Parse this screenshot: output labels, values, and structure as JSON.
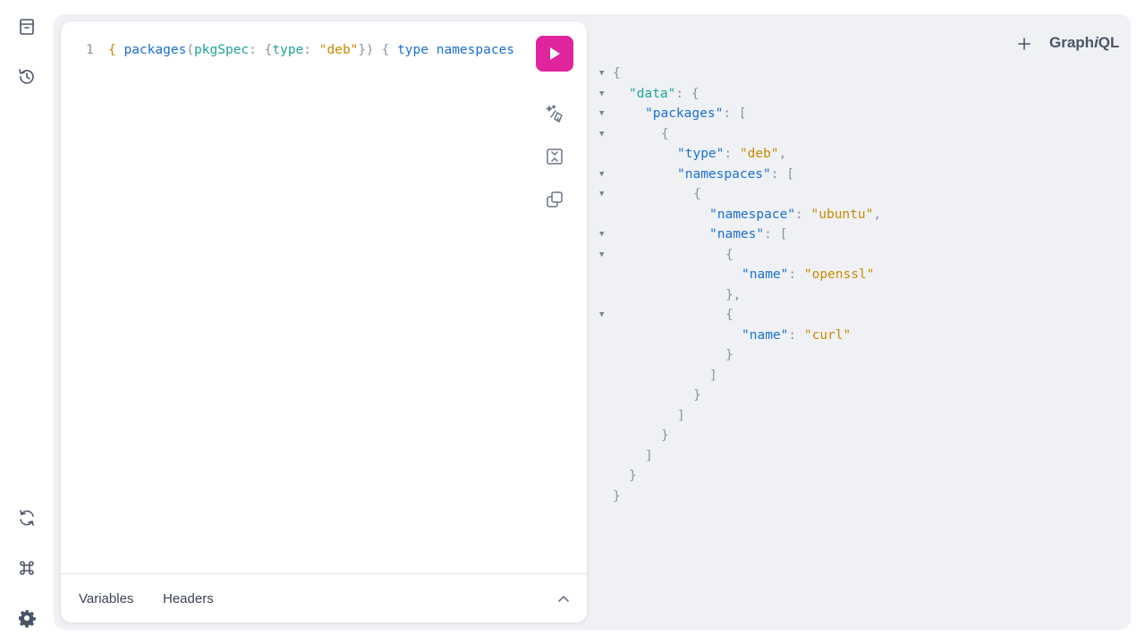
{
  "sidebar": {
    "top_icons": [
      "docs-icon",
      "history-icon"
    ],
    "bottom_icons": [
      "refetch-schema-icon",
      "keyboard-shortcuts-icon",
      "settings-icon"
    ]
  },
  "editor": {
    "line_number": "1",
    "query_tokens": {
      "open_brace": "{",
      "packages": "packages",
      "open_paren": "(",
      "pkgSpec": "pkgSpec",
      "colon1": ":",
      "open_obj": "{",
      "type_arg": "type",
      "colon2": ":",
      "deb_value": "\"deb\"",
      "close_obj_paren": "})",
      "open_brace2": "{",
      "type_field": "type",
      "namespaces_field": "namespaces"
    },
    "run_button_icon": "play-icon",
    "tool_icons": [
      "prettify-icon",
      "merge-fragments-icon",
      "copy-icon"
    ]
  },
  "footer": {
    "variables_label": "Variables",
    "headers_label": "Headers"
  },
  "header": {
    "add_tab_icon": "plus-icon",
    "logo_prefix": "Graph",
    "logo_italic": "i",
    "logo_suffix": "QL"
  },
  "result": {
    "data_key": "\"data\"",
    "packages_key": "\"packages\"",
    "type_key": "\"type\"",
    "type_value": "\"deb\"",
    "namespaces_key": "\"namespaces\"",
    "namespace_key": "\"namespace\"",
    "namespace_value": "\"ubuntu\"",
    "names_key": "\"names\"",
    "name_key_1": "\"name\"",
    "name_value_1": "\"openssl\"",
    "name_key_2": "\"name\"",
    "name_value_2": "\"curl\""
  },
  "colors": {
    "accent": "#e0249c",
    "field": "#1a6fd4",
    "string": "#c98a00",
    "argument": "#1fa59b"
  }
}
